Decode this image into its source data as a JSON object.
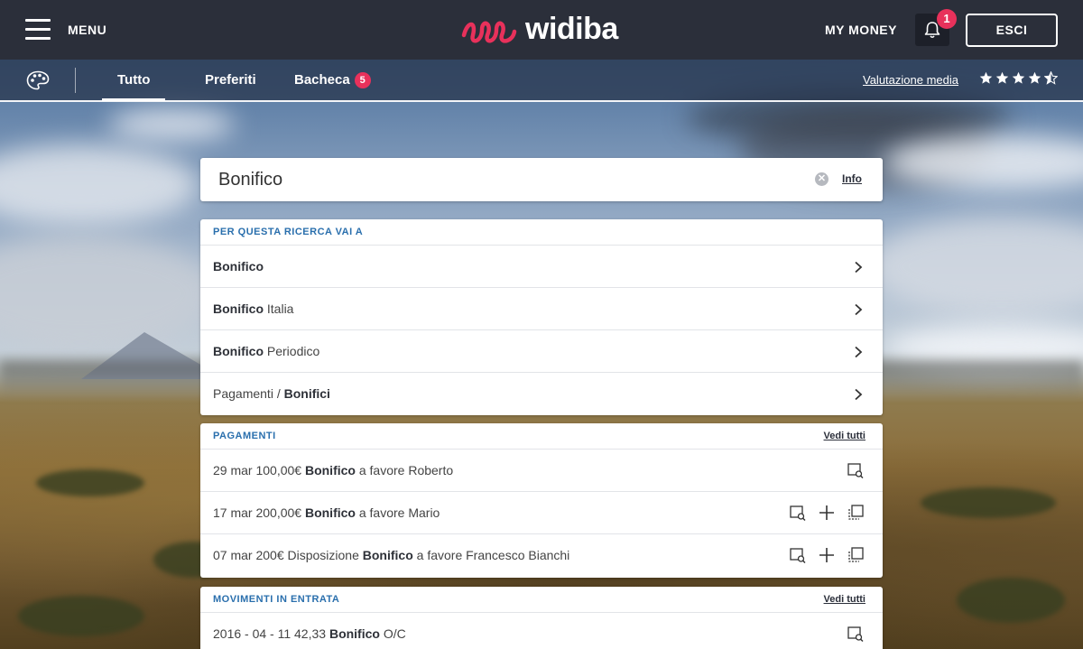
{
  "header": {
    "menu_label": "MENU",
    "logo_text": "widiba",
    "my_money_label": "MY MONEY",
    "notification_count": "1",
    "logout_label": "ESCI"
  },
  "subnav": {
    "tabs": [
      {
        "label": "Tutto",
        "active": true
      },
      {
        "label": "Preferiti",
        "active": false
      },
      {
        "label": "Bacheca",
        "badge": "5",
        "active": false
      }
    ],
    "rating_label": "Valutazione media",
    "rating_value": 4.5,
    "rating_max": 5
  },
  "search": {
    "value": "Bonifico",
    "info_label": "Info"
  },
  "quick_links": {
    "title": "PER QUESTA RICERCA VAI A",
    "items": [
      {
        "bold": "Bonifico",
        "rest": ""
      },
      {
        "bold": "Bonifico",
        "rest": " Italia"
      },
      {
        "bold": "Bonifico",
        "rest": " Periodico"
      },
      {
        "pre": "Pagamenti / ",
        "bold": "Bonifici"
      }
    ]
  },
  "pagamenti": {
    "title": "PAGAMENTI",
    "see_all": "Vedi tutti",
    "items": [
      {
        "pre": "29 mar 100,00€ ",
        "bold": "Bonifico",
        "post": " a favore Roberto"
      },
      {
        "pre": "17 mar 200,00€ ",
        "bold": "Bonifico",
        "post": " a favore Mario"
      },
      {
        "pre": "07 mar 200€ Disposizione ",
        "bold": "Bonifico",
        "post": " a favore Francesco Bianchi"
      }
    ]
  },
  "movimenti": {
    "title": "MOVIMENTI IN ENTRATA",
    "see_all": "Vedi tutti",
    "items": [
      {
        "pre": "2016 - 04 - 11 42,33 ",
        "bold": "Bonifico",
        "post": " O/C"
      }
    ]
  },
  "colors": {
    "brand_pink": "#e8315b",
    "header_bg": "#2b2f3a",
    "section_title": "#2a6fad"
  },
  "icons": [
    "menu-icon",
    "bell-icon",
    "palette-icon",
    "star-icon",
    "star-half-icon",
    "clear-icon",
    "chevron-right-icon",
    "details-icon",
    "plus-icon",
    "copy-icon"
  ]
}
